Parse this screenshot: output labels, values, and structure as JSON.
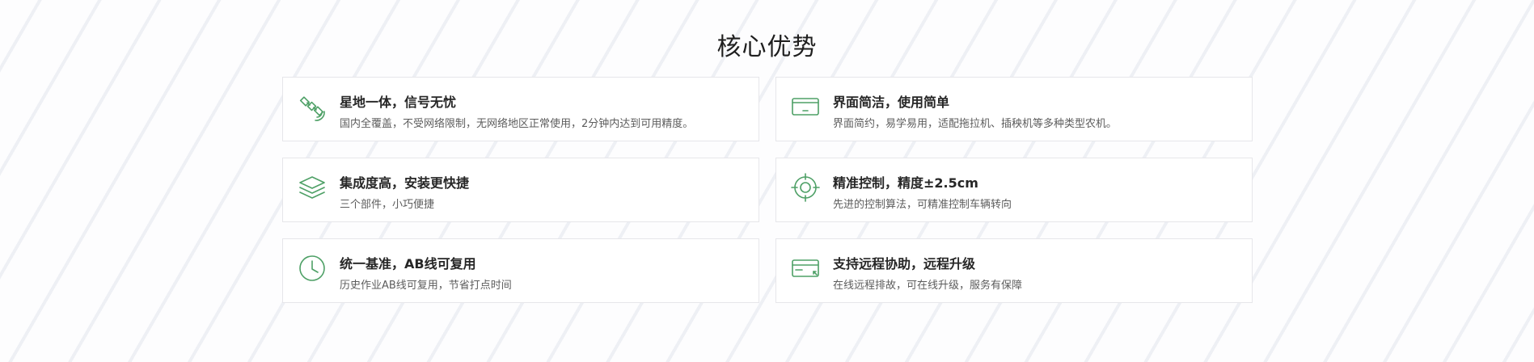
{
  "section": {
    "title": "核心优势"
  },
  "colors": {
    "accent": "#4ea066",
    "title_text": "#262626",
    "desc_text": "#5c5c5c",
    "card_border": "#e6e6ea"
  },
  "features": [
    {
      "icon": "satellite-icon",
      "title": "星地一体，信号无忧",
      "desc": "国内全覆盖，不受网络限制，无网络地区正常使用，2分钟内达到可用精度。"
    },
    {
      "icon": "screen-icon",
      "title": "界面简洁，使用简单",
      "desc": "界面简约，易学易用，适配拖拉机、插秧机等多种类型农机。"
    },
    {
      "icon": "layers-icon",
      "title": "集成度高，安装更快捷",
      "desc": "三个部件，小巧便捷"
    },
    {
      "icon": "target-icon",
      "title": "精准控制，精度±2.5cm",
      "desc": "先进的控制算法，可精准控制车辆转向"
    },
    {
      "icon": "clock-icon",
      "title": "统一基准，AB线可复用",
      "desc": "历史作业AB线可复用，节省打点时间"
    },
    {
      "icon": "remote-card-icon",
      "title": "支持远程协助，远程升级",
      "desc": "在线远程排故，可在线升级，服务有保障"
    }
  ]
}
